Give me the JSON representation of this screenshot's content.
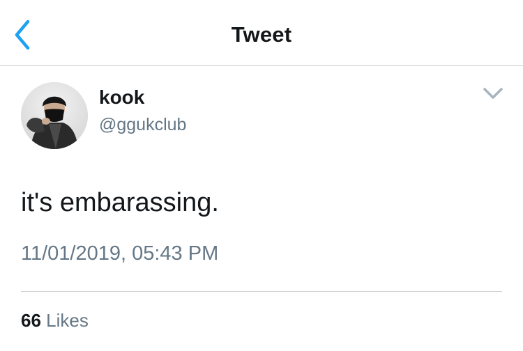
{
  "header": {
    "title": "Tweet",
    "back_icon": "chevron-left-icon",
    "accent_color": "#1da1f2"
  },
  "tweet": {
    "author": {
      "display_name": "kook",
      "handle": "@ggukclub",
      "avatar_icon": "user-avatar"
    },
    "more_icon": "chevron-down-icon",
    "text": "it's embarassing.",
    "timestamp": "11/01/2019, 05:43 PM",
    "stats": {
      "likes_count": "66",
      "likes_label": "Likes"
    }
  }
}
